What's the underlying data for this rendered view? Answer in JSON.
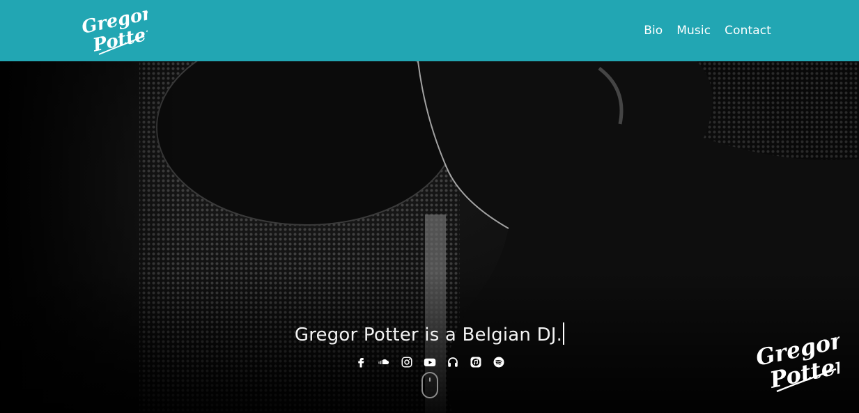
{
  "brand": {
    "name_line1": "Gregor",
    "name_line2": "Potter"
  },
  "nav": {
    "items": [
      {
        "label": "Bio"
      },
      {
        "label": "Music"
      },
      {
        "label": "Contact"
      }
    ]
  },
  "hero": {
    "tagline": "Gregor Potter is a Belgian DJ.",
    "socials": [
      {
        "icon": "facebook-icon"
      },
      {
        "icon": "soundcloud-icon"
      },
      {
        "icon": "instagram-icon"
      },
      {
        "icon": "youtube-icon"
      },
      {
        "icon": "headphones-icon"
      },
      {
        "icon": "itunes-icon"
      },
      {
        "icon": "spotify-icon"
      }
    ]
  },
  "colors": {
    "header_bg": "#22a6b3",
    "text": "#ffffff"
  }
}
